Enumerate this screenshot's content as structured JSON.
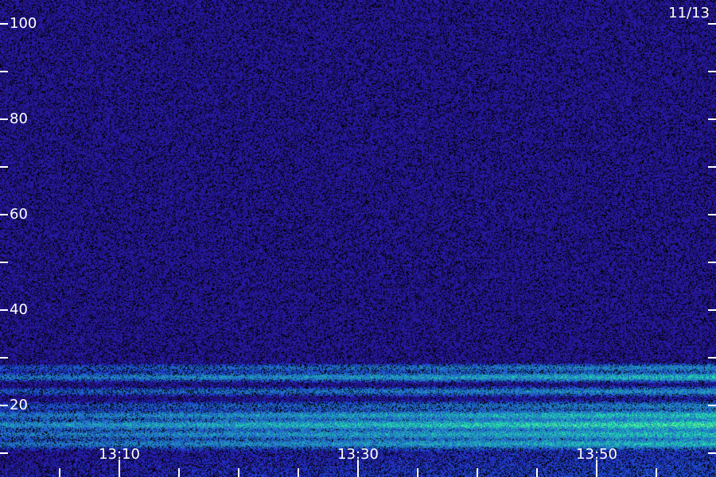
{
  "chart_data": {
    "type": "heatmap",
    "date": "11/13",
    "y_ticks": [
      "20",
      "40",
      "60",
      "80",
      "100"
    ],
    "y_tick_values": [
      20,
      40,
      60,
      80,
      100
    ],
    "y_minor_tick_values": [
      10,
      30,
      50,
      70,
      90
    ],
    "ylim": [
      5,
      105
    ],
    "x_ticks": [
      "13:10",
      "13:30",
      "13:50"
    ],
    "x_tick_values_min": [
      10,
      30,
      50
    ],
    "x_minor_tick_values_min": [
      5,
      15,
      20,
      25,
      35,
      40,
      45,
      55
    ],
    "xlim_min": [
      0,
      60
    ],
    "colors": {
      "background": "#2a0a7a",
      "mid": "#1f2fd0",
      "high": "#22f0a8",
      "peak": "#b8ff60"
    },
    "bands": [
      {
        "y": 28,
        "intensity": 0.45
      },
      {
        "y": 26,
        "intensity": 0.65
      },
      {
        "y": 23,
        "intensity": 0.45
      },
      {
        "y": 20,
        "intensity": 0.35
      },
      {
        "y": 18,
        "intensity": 0.6
      },
      {
        "y": 16,
        "intensity": 0.75
      },
      {
        "y": 14,
        "intensity": 0.55
      },
      {
        "y": 12,
        "intensity": 0.5
      }
    ]
  }
}
